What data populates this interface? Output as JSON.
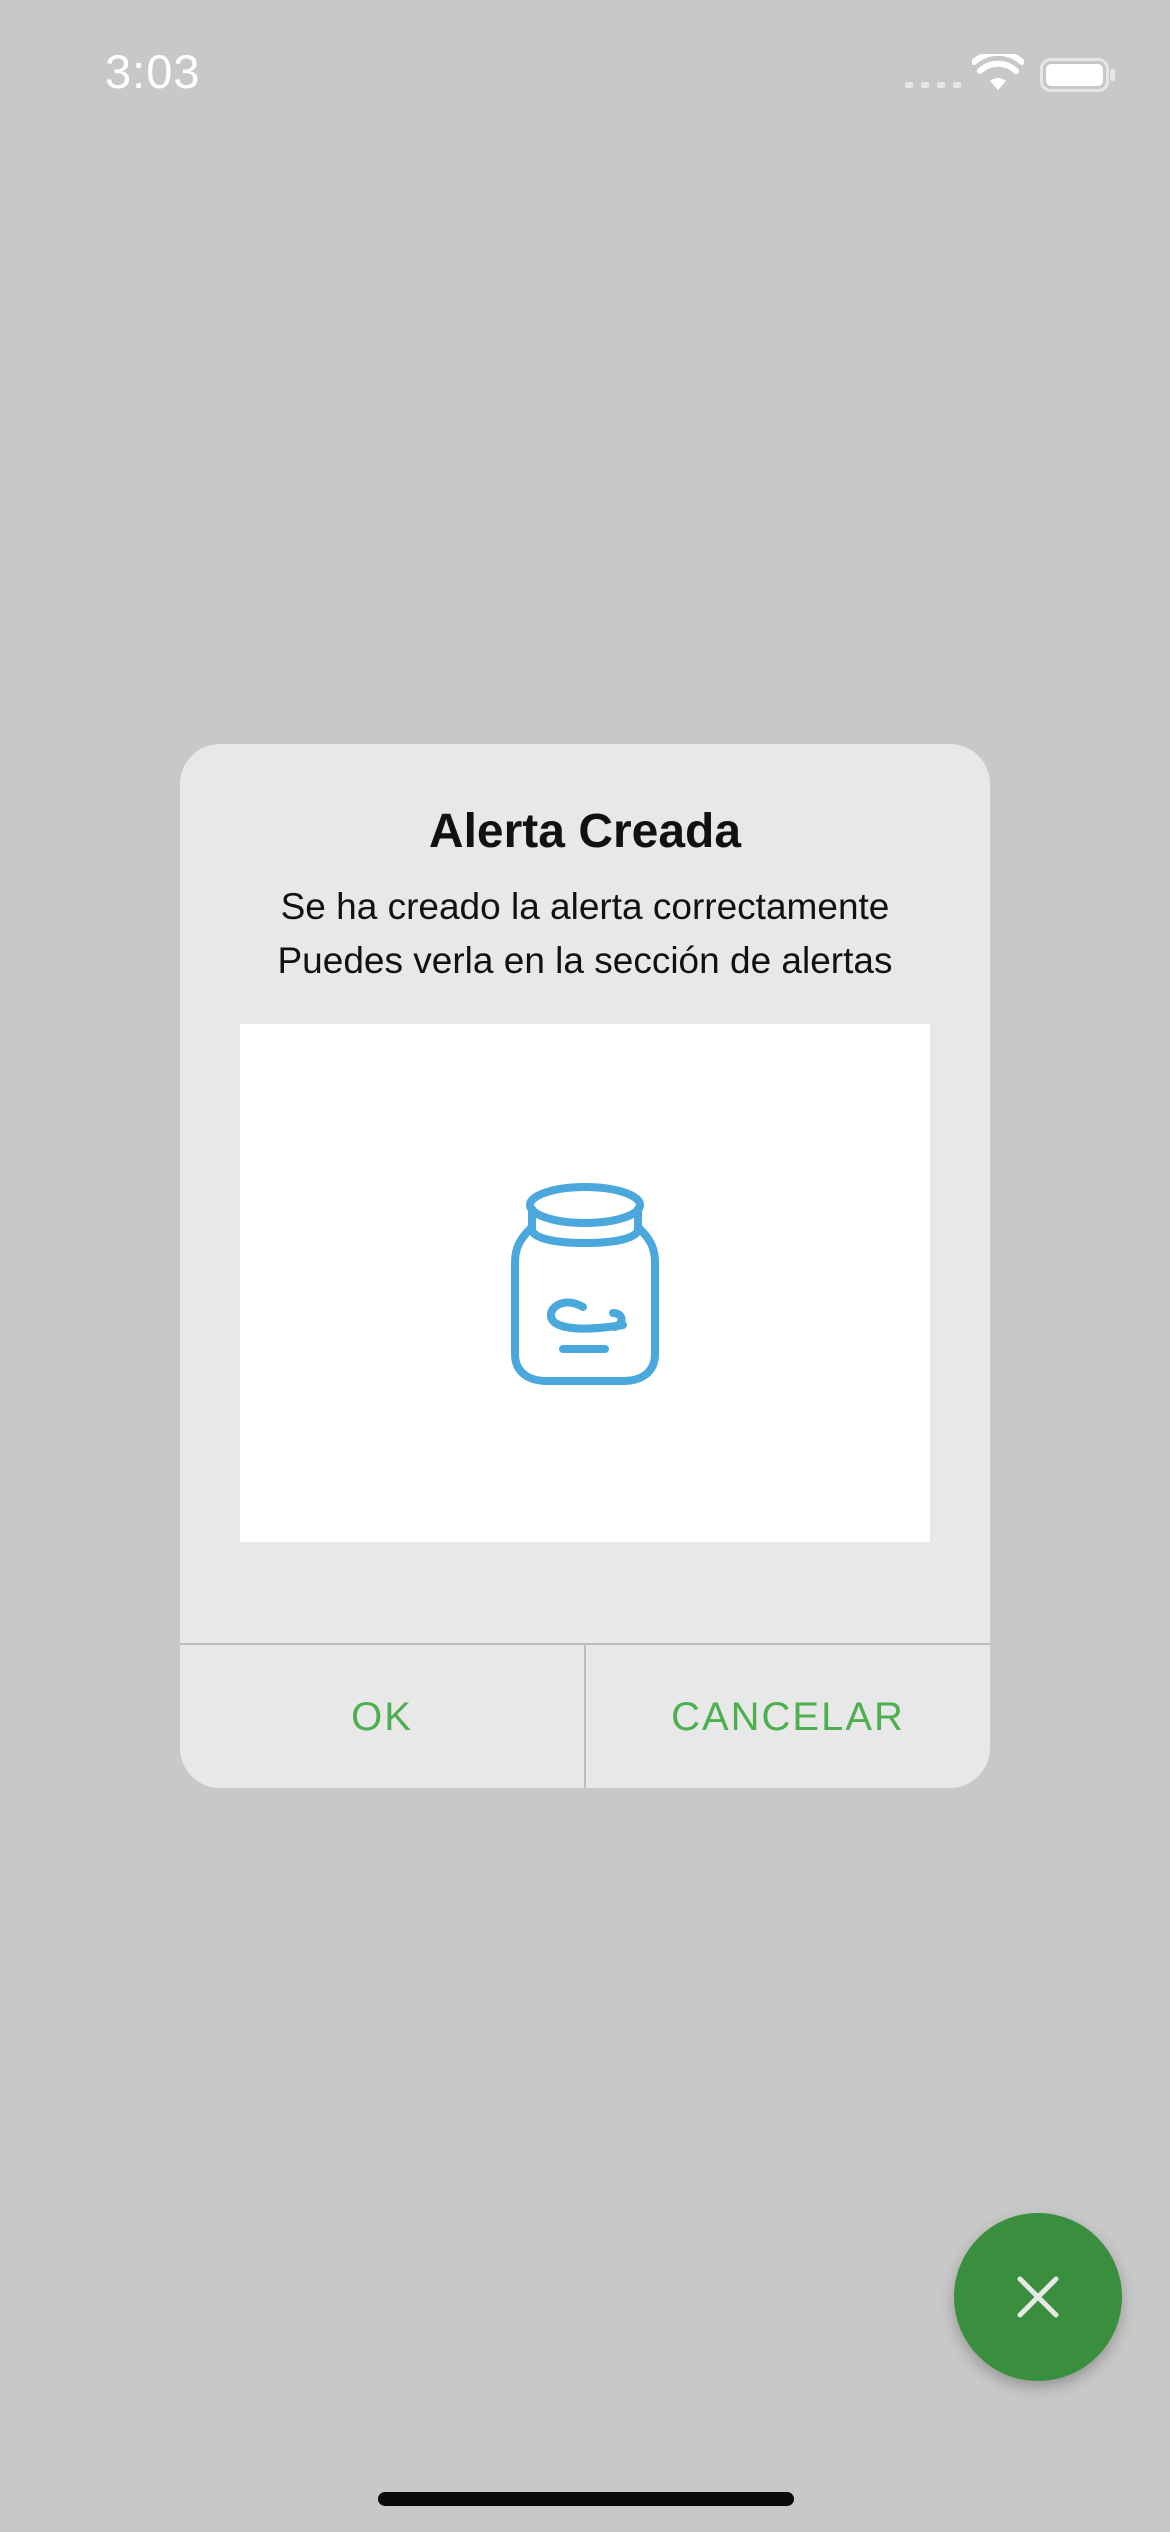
{
  "status_bar": {
    "time": "3:03",
    "icons": [
      "cellular-signal-icon",
      "wifi-icon",
      "battery-icon"
    ]
  },
  "dialog": {
    "title": "Alerta Creada",
    "message_line1": "Se ha creado la alerta correctamente",
    "message_line2": "Puedes verla en la sección de alertas",
    "image_icon": "jar-icon",
    "ok_label": "OK",
    "cancel_label": "CANCELAR"
  },
  "fab": {
    "icon": "close-icon"
  },
  "colors": {
    "overlay_background": "#c8c8c8",
    "dialog_background": "#e8e8e8",
    "accent_green": "#4caf50",
    "fab_green": "#3a8f3f",
    "jar_blue": "#4aa8dc"
  }
}
